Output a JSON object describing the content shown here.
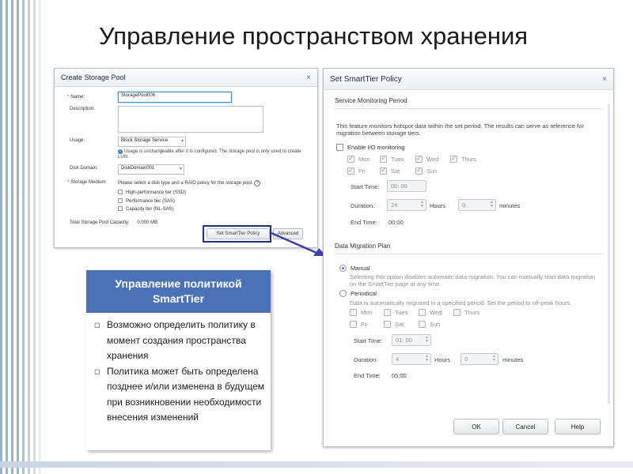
{
  "slide": {
    "title": "Управление пространством хранения"
  },
  "create_pool": {
    "title": "Create Storage Pool",
    "close": "×",
    "name_label": "Name:",
    "name_value": "StoragePool006",
    "description_label": "Description:",
    "usage_label": "Usage:",
    "usage_value": "Block Storage Service",
    "usage_note": "Usage is unchangeable after it is configured. The storage pool is only used to create LUN.",
    "disk_domain_label": "Disk Domain:",
    "disk_domain_value": "DiskDomain001",
    "storage_medium_label": "Storage Medium:",
    "storage_medium_hint": "Please select a disk type and a RAID policy for the storage pool.",
    "tiers": [
      "High-performance tier (SSD)",
      "Performance tier (SAS)",
      "Capacity tier (NL-SAS)"
    ],
    "capacity_label": "Total Storage Pool Capacity:",
    "capacity_value": "0.000 MB",
    "smarttier_button": "Set SmartTier Policy",
    "advanced_button": "Advanced"
  },
  "smarttier": {
    "title": "Set SmartTier Policy",
    "close": "×",
    "monitoring": {
      "section_title": "Service Monitoring Period",
      "description": "This feature monitors hotspot data within the set period. The results can serve as reference for migration between storage tiers.",
      "enable_label": "Enable I/O monitoring",
      "days": [
        "Mon",
        "Tues",
        "Wed",
        "Thurs",
        "Fri",
        "Sat",
        "Sun"
      ],
      "start_time_label": "Start Time:",
      "start_time_value": "00: 00",
      "duration_label": "Duration:",
      "hours_value": "24",
      "hours_label": "Hours",
      "minutes_value": "0",
      "minutes_label": "minutes",
      "end_time_label": "End Time:",
      "end_time_value": "00:00"
    },
    "migration": {
      "section_title": "Data Migration Plan",
      "manual_label": "Manual",
      "manual_desc": "Selecting this option disables automatic data migration. You can manually start data migration on the SmartTier page at any time.",
      "periodical_label": "Periodical",
      "periodical_desc": "Data is automatically migrated in a specified period. Set the period to off-peak hours.",
      "days": [
        "Mon",
        "Tues",
        "Wed",
        "Thurs",
        "Fri",
        "Sat",
        "Sun"
      ],
      "start_time_label": "Start Time:",
      "start_time_value": "01: 00",
      "duration_label": "Duration:",
      "hours_value": "4",
      "hours_label": "Hours",
      "minutes_value": "0",
      "minutes_label": "minutes",
      "end_time_label": "End Time:",
      "end_time_value": "05:00"
    },
    "buttons": {
      "ok": "OK",
      "cancel": "Cancel",
      "help": "Help"
    }
  },
  "card": {
    "title_line1": "Управление политикой",
    "title_line2": "SmartTier",
    "bullets": [
      "Возможно определить политику в момент создания пространства хранения",
      "Политика может быть определена позднее и/или изменена в будущем при возникновении необходимости внесения изменений"
    ]
  },
  "colors": {
    "card_header": "#4b72b6",
    "highlight": "#1e2c8c",
    "arrow": "#3b3fb0"
  }
}
